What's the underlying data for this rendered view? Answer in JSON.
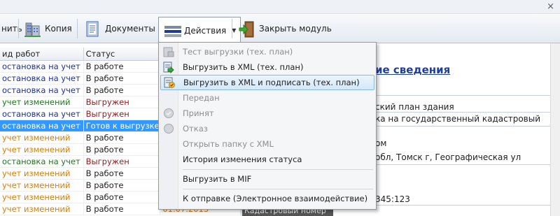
{
  "window": {
    "close_glyph": "×"
  },
  "toolbar": {
    "partial_label": "нить",
    "copy_label": "Копия",
    "documents_label": "Документы",
    "actions_label": "Действия",
    "close_module_label": "Закрыть модуль"
  },
  "grid": {
    "columns": [
      "ид работ",
      "Статус",
      ""
    ],
    "rows": [
      {
        "type": "остановка на учет",
        "status": "В работе",
        "type_color": "#1a2fb0",
        "status_color": "#1e1e1e",
        "date": ""
      },
      {
        "type": "остановка на учет",
        "status": "В работе",
        "type_color": "#1a2fb0",
        "status_color": "#1e1e1e",
        "date": ""
      },
      {
        "type": "остановка на учет",
        "status": "В работе",
        "type_color": "#1a2fb0",
        "status_color": "#1e1e1e",
        "date": ""
      },
      {
        "type": "учет изменений",
        "status": "Выгружен",
        "type_color": "#1d7a1d",
        "status_color": "#9c1a1a",
        "date": ""
      },
      {
        "type": "остановка на учет",
        "status": "Выгружен",
        "type_color": "#1a2fb0",
        "status_color": "#9c1a1a",
        "date": ""
      },
      {
        "type": "остановка на учет",
        "status": "Готов к выгрузке",
        "type_color": "#1a2fb0",
        "status_color": "#1e1e1e",
        "date": "",
        "selected": true
      },
      {
        "type": "учет изменений",
        "status": "В работе",
        "type_color": "#e07b00",
        "status_color": "#1e1e1e",
        "date": ""
      },
      {
        "type": "учет изменений",
        "status": "В работе",
        "type_color": "#e07b00",
        "status_color": "#1e1e1e",
        "date": ""
      },
      {
        "type": "остановка на учет",
        "status": "Выгружен",
        "type_color": "#1d7a1d",
        "status_color": "#9c1a1a",
        "date": ""
      },
      {
        "type": "учет изменений",
        "status": "В работе",
        "type_color": "#e07b00",
        "status_color": "#1e1e1e",
        "date": ""
      },
      {
        "type": "учет изменений",
        "status": "В работе",
        "type_color": "#e07b00",
        "status_color": "#1e1e1e",
        "date": ""
      },
      {
        "type": "учет изменений",
        "status": "В работе",
        "type_color": "#e07b00",
        "status_color": "#1e1e1e",
        "date": ""
      },
      {
        "type": "учет изменений",
        "status": "В работе",
        "type_color": "#e07b00",
        "status_color": "#1e1e1e",
        "date": "01.07.2013"
      }
    ]
  },
  "right_panel": {
    "heading": "ие сведения",
    "lines": [
      "ский план здания",
      "ка на государственный кадастровый",
      "ом",
      "обл, Томск г, Географическая ул",
      "345:123"
    ],
    "footer_label": "Кадастровый номер"
  },
  "menu": {
    "items": [
      {
        "label": "Тест выгрузки (тех. план)",
        "disabled": true,
        "icon": "test-upload-icon"
      },
      {
        "label": "Выгрузить в XML (тех. план)",
        "disabled": false,
        "icon": "export-xml-icon"
      },
      {
        "label": "Выгрузить в XML и подписать (тех. план)",
        "disabled": false,
        "icon": "export-sign-icon",
        "highlighted": true
      },
      {
        "label": "Передан",
        "disabled": true,
        "icon": ""
      },
      {
        "label": "Принят",
        "disabled": true,
        "icon": "accepted-icon"
      },
      {
        "label": "Отказ",
        "disabled": true,
        "icon": "rejected-icon"
      },
      {
        "label": "Открыть папку с XML",
        "disabled": true,
        "icon": ""
      },
      {
        "label": "История изменения статуса",
        "disabled": false,
        "icon": ""
      },
      {
        "label": "Выгрузить в MIF",
        "disabled": false,
        "icon": ""
      },
      {
        "label": "К отправке (Электронное взаимодействие)",
        "disabled": false,
        "icon": ""
      }
    ]
  },
  "colors": {
    "selection": "#3399ff",
    "menu_highlight_border": "#8ab6e2",
    "heading": "#1f3f9f"
  }
}
